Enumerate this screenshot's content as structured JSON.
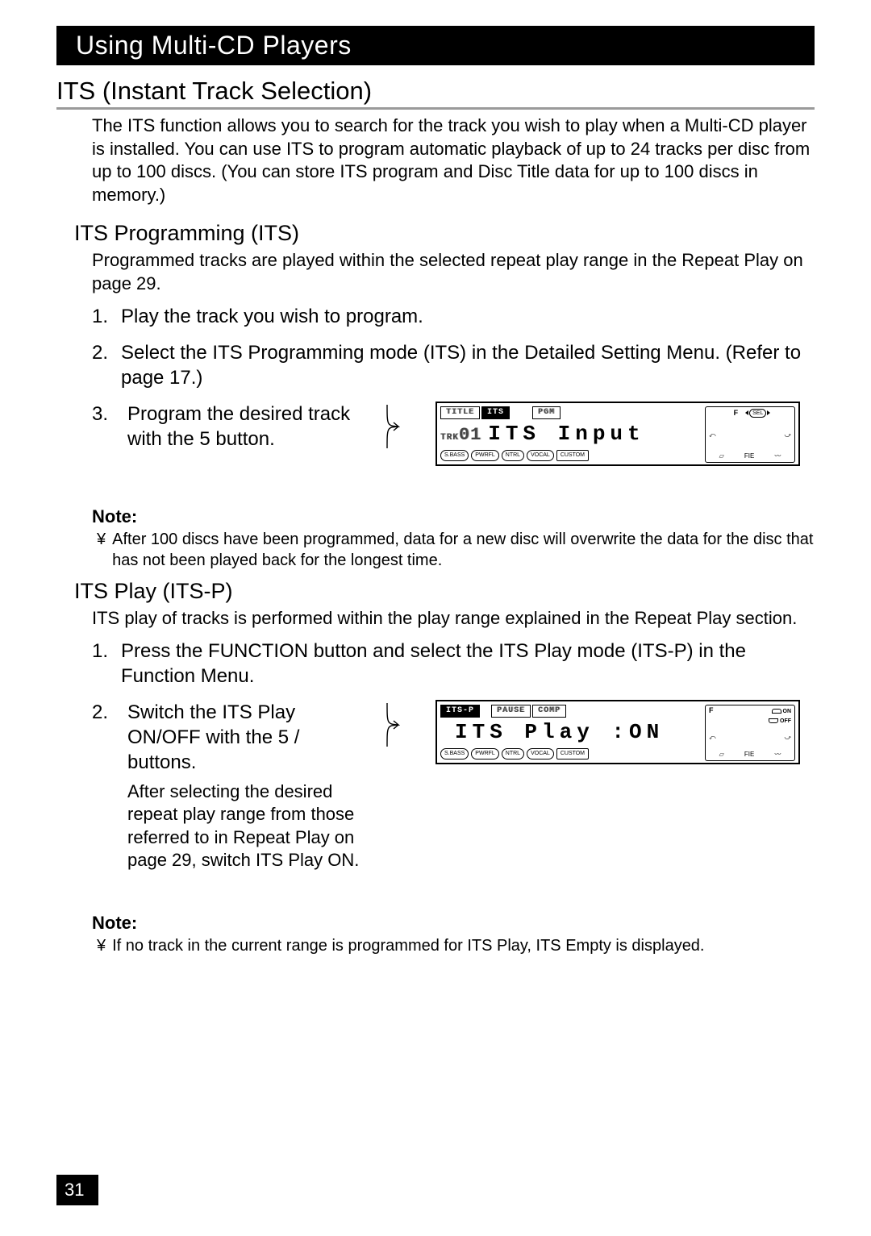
{
  "chapter_title": "Using Multi-CD Players",
  "section_h1": "ITS (Instant Track Selection)",
  "intro": "The ITS function allows you to search for the track you wish to play when a Multi-CD player is installed. You can use ITS to program automatic playback of up to 24 tracks per disc from up to 100 discs. (You can store ITS program and Disc Title data for up to 100 discs in memory.)",
  "prog": {
    "h2": "ITS Programming (ITS)",
    "lead": "Programmed tracks are played within the selected repeat play range in the  Repeat Play on page 29.",
    "step1": "Play the track you wish to program.",
    "step2": "Select the ITS Programming mode (ITS) in the Detailed Setting Menu. (Refer to page 17.)",
    "step3_main": "Program the desired track with the 5  button.",
    "note_label": "Note:",
    "note_bullet": "¥",
    "note_text": "After 100 discs have been programmed, data for a new disc will overwrite the data for the disc that has not been played back for the longest time."
  },
  "lcd1": {
    "tabs": {
      "title": "TITLE",
      "its": "ITS",
      "pgm": "PGM"
    },
    "trk_label": "TRK",
    "trk_num": "01",
    "big": "ITS Input",
    "pills": [
      "S.BASS",
      "PWRFL",
      "NTRL",
      "VOCAL",
      "CUSTOM"
    ],
    "side_f": "F",
    "side_sel": "SEL",
    "side_fie": "FIE"
  },
  "play": {
    "h2": "ITS Play (ITS-P)",
    "lead": "ITS play of tracks is performed within the play range explained in the  Repeat Play  section.",
    "step1": "Press the FUNCTION button and select the ITS Play mode (ITS-P) in the Function Menu.",
    "step2_main": "Switch the ITS Play ON/OFF with the 5 /    buttons.",
    "step2_sub": "After selecting the desired repeat play range from those referred to in  Repeat Play  on page 29, switch ITS Play ON.",
    "note_label": "Note:",
    "note_bullet": "¥",
    "note_text": "If no track in the current range is programmed for ITS Play,  ITS Empty  is displayed."
  },
  "lcd2": {
    "tabs": {
      "itsp": "ITS-P",
      "pause": "PAUSE",
      "comp": "COMP"
    },
    "big": "ITS Play :ON",
    "pills": [
      "S.BASS",
      "PWRFL",
      "NTRL",
      "VOCAL",
      "CUSTOM"
    ],
    "side_f": "F",
    "side_on": "ON",
    "side_off": "OFF",
    "side_fie": "FIE"
  },
  "page_number": "31"
}
